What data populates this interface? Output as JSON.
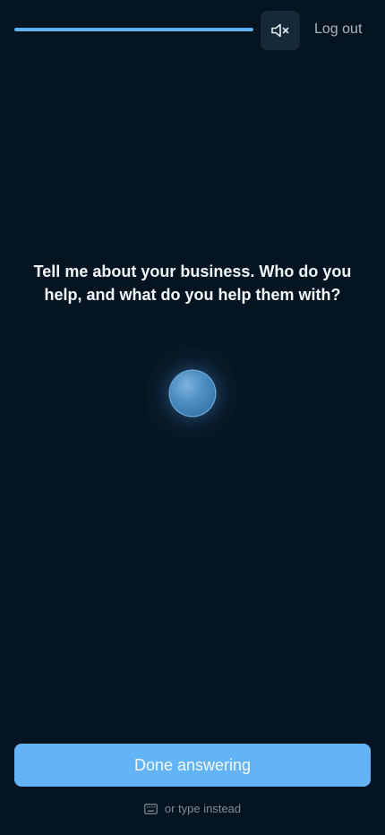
{
  "header": {
    "progress_percent": 100,
    "mute_icon": "speaker-muted-icon",
    "logout_label": "Log out"
  },
  "main": {
    "question": "Tell me about your business. Who do you help, and what do you help them with?",
    "orb_icon": "voice-orb"
  },
  "footer": {
    "done_label": "Done answering",
    "type_instead_label": "or type instead",
    "keyboard_icon": "keyboard-icon"
  },
  "colors": {
    "background": "#061421",
    "accent": "#62b4f6",
    "progress": "#5db2f3",
    "muted_text": "#aab6c2"
  }
}
